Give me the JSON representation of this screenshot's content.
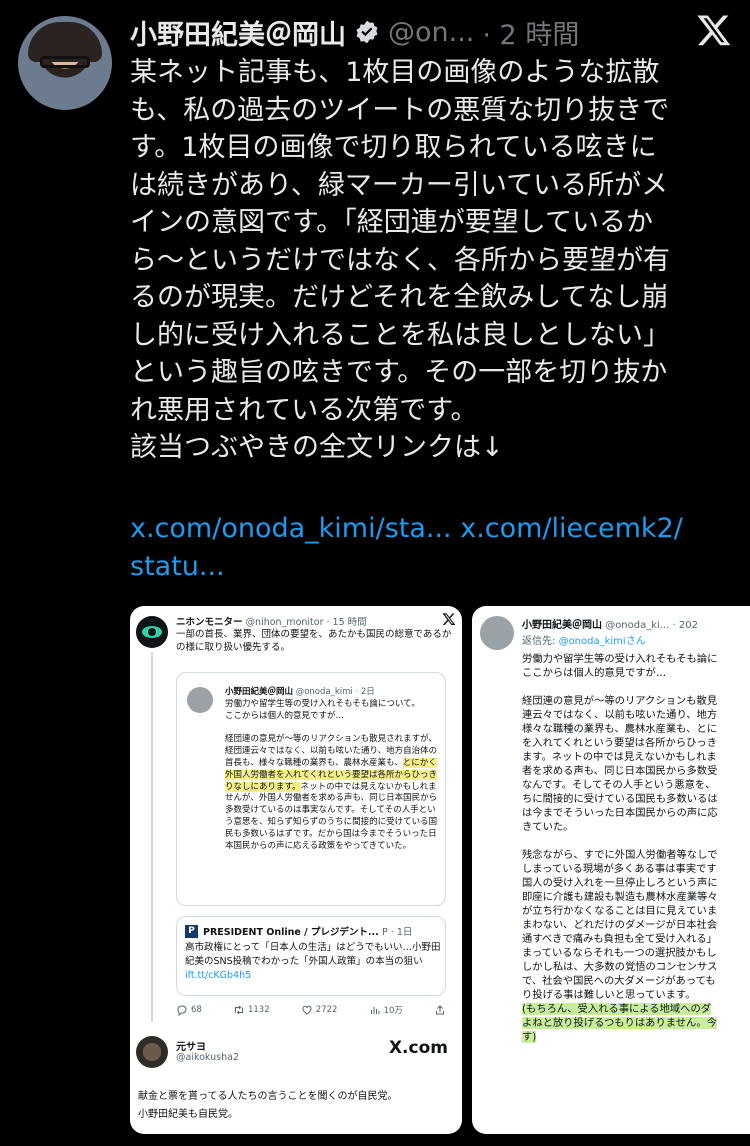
{
  "author": {
    "name": "小野田紀美＠岡山",
    "handle": "@on...",
    "time": "· 2 時間"
  },
  "icons": [
    "avatar",
    "verified-badge-icon",
    "x-logo-icon",
    "reply-icon",
    "retweet-icon",
    "like-icon",
    "views-icon",
    "share-icon"
  ],
  "tweet": {
    "text": "某ネット記事も、1枚目の画像のような拡散\nも、私の過去のツイートの悪質な切り抜きで\nす。1枚目の画像で切り取られている呟きに\nは続きがあり、緑マーカー引いている所がメ\nインの意図です。「経団連が要望しているか\nら〜というだけではなく、各所から要望が有\nるのが現実。だけどそれを全飲みしてなし崩\nし的に受け入れることを私は良しとしない」\nという趣旨の呟きです。その一部を切り抜か\nれ悪用されている次第です。\n該当つぶやきの全文リンクは↓",
    "link1": "x.com/onoda_kimi/sta...",
    "link2": "x.com/liecemk2/",
    "link3": "statu..."
  },
  "image1": {
    "main": {
      "name": "ニホンモニター",
      "handle": "@nihon_monitor · 15 時間",
      "text": "一部の首長、業界、団体の要望を、あたかも国民の総意であるかの様に取り扱い優先する。"
    },
    "quote": {
      "name": "小野田紀美＠岡山",
      "handle": "@onoda_kimi · 2日",
      "text_before": "労働力や留学生等の受け入れそもそも論について。\nここからは個人的意見ですが…\n\n経団連の意見が〜等のリアクションも散見されますが、経団連云々ではなく、以前も呟いた通り、地方自治体の首長も、様々な職種の業界も、農林水産業も、",
      "text_highlight": "とにかく外国人労働者を入れてくれという要望は各所からひっきりなしにあります。",
      "text_after": "ネットの中では見えないかもしれませんが、外国人労働者を求める声も、同じ日本国民から多数受けているのは事実なんです。そしてその人手という意思を、知らず知らずのうちに間接的に受けている国民も多数いるはずです。だから国は今までそういった日本国民からの声に応える政策をやってきていた。"
    },
    "card": {
      "source": "PRESIDENT Online / プレジデント...",
      "source_meta": "P · 1日",
      "text": "高市政権にとって「日本人の生活」はどうでもいい…小野田紀美のSNS投稿でわかった「外国人政策」の本当の狙い",
      "link": "ift.tt/cKGb4h5"
    },
    "stats": {
      "replies": "68",
      "retweets": "1132",
      "likes": "2722",
      "views": "10万"
    },
    "reply": {
      "name": "元サヨ",
      "handle": "@aikokusha2",
      "brand": "X.com",
      "text": "献金と票を貰ってる人たちの言うことを聞くのが自民党。\n小野田紀美も自民党。"
    }
  },
  "image2": {
    "name": "小野田紀美＠岡山",
    "handle": "@onoda_ki... · 202",
    "reply_prefix": "返信先: ",
    "reply_to": "@onoda_kimiさん",
    "text_before": "労働力や留学生等の受け入れそもそも論に\nここからは個人的意見ですが…\n\n経団連の意見が〜等のリアクションも散見\n連云々ではなく、以前も呟いた通り、地方\n様々な職種の業界も、農林水産業も、とに\nを入れてくれという要望は各所からひっき\nます。ネットの中では見えないかもしれま\n者を求める声も、同じ日本国民から多数受\nなんです。そしてその人手という悪意を、\nちに間接的に受けている国民も多数いるは\nは今までそういった日本国民からの声に応\nきていた。\n\n残念ながら、すでに外国人労働者等なしで\nしまっている現場が多くある事は事実です\n国人の受け入れを一旦停止しろという声に\n即座に介護も建設も製造も農林水産業等々\nが立ち行かなくなることは目に見えていま\nまわない、どれだけのダメージが日本社会\n通すべきで痛みも負担も全て受け入れる」\nまっているならそれも一つの選択肢かもし\nしかし私は、大多数の覚悟のコンセンサス\nで、社会や国民への大ダメージがあっても\nり投げる事は難しいと思っています。\n",
    "text_highlight": "(もちろん、受入れる事による地域へのダ\nよねと放り投げるつもりはありません。今\nす)"
  }
}
